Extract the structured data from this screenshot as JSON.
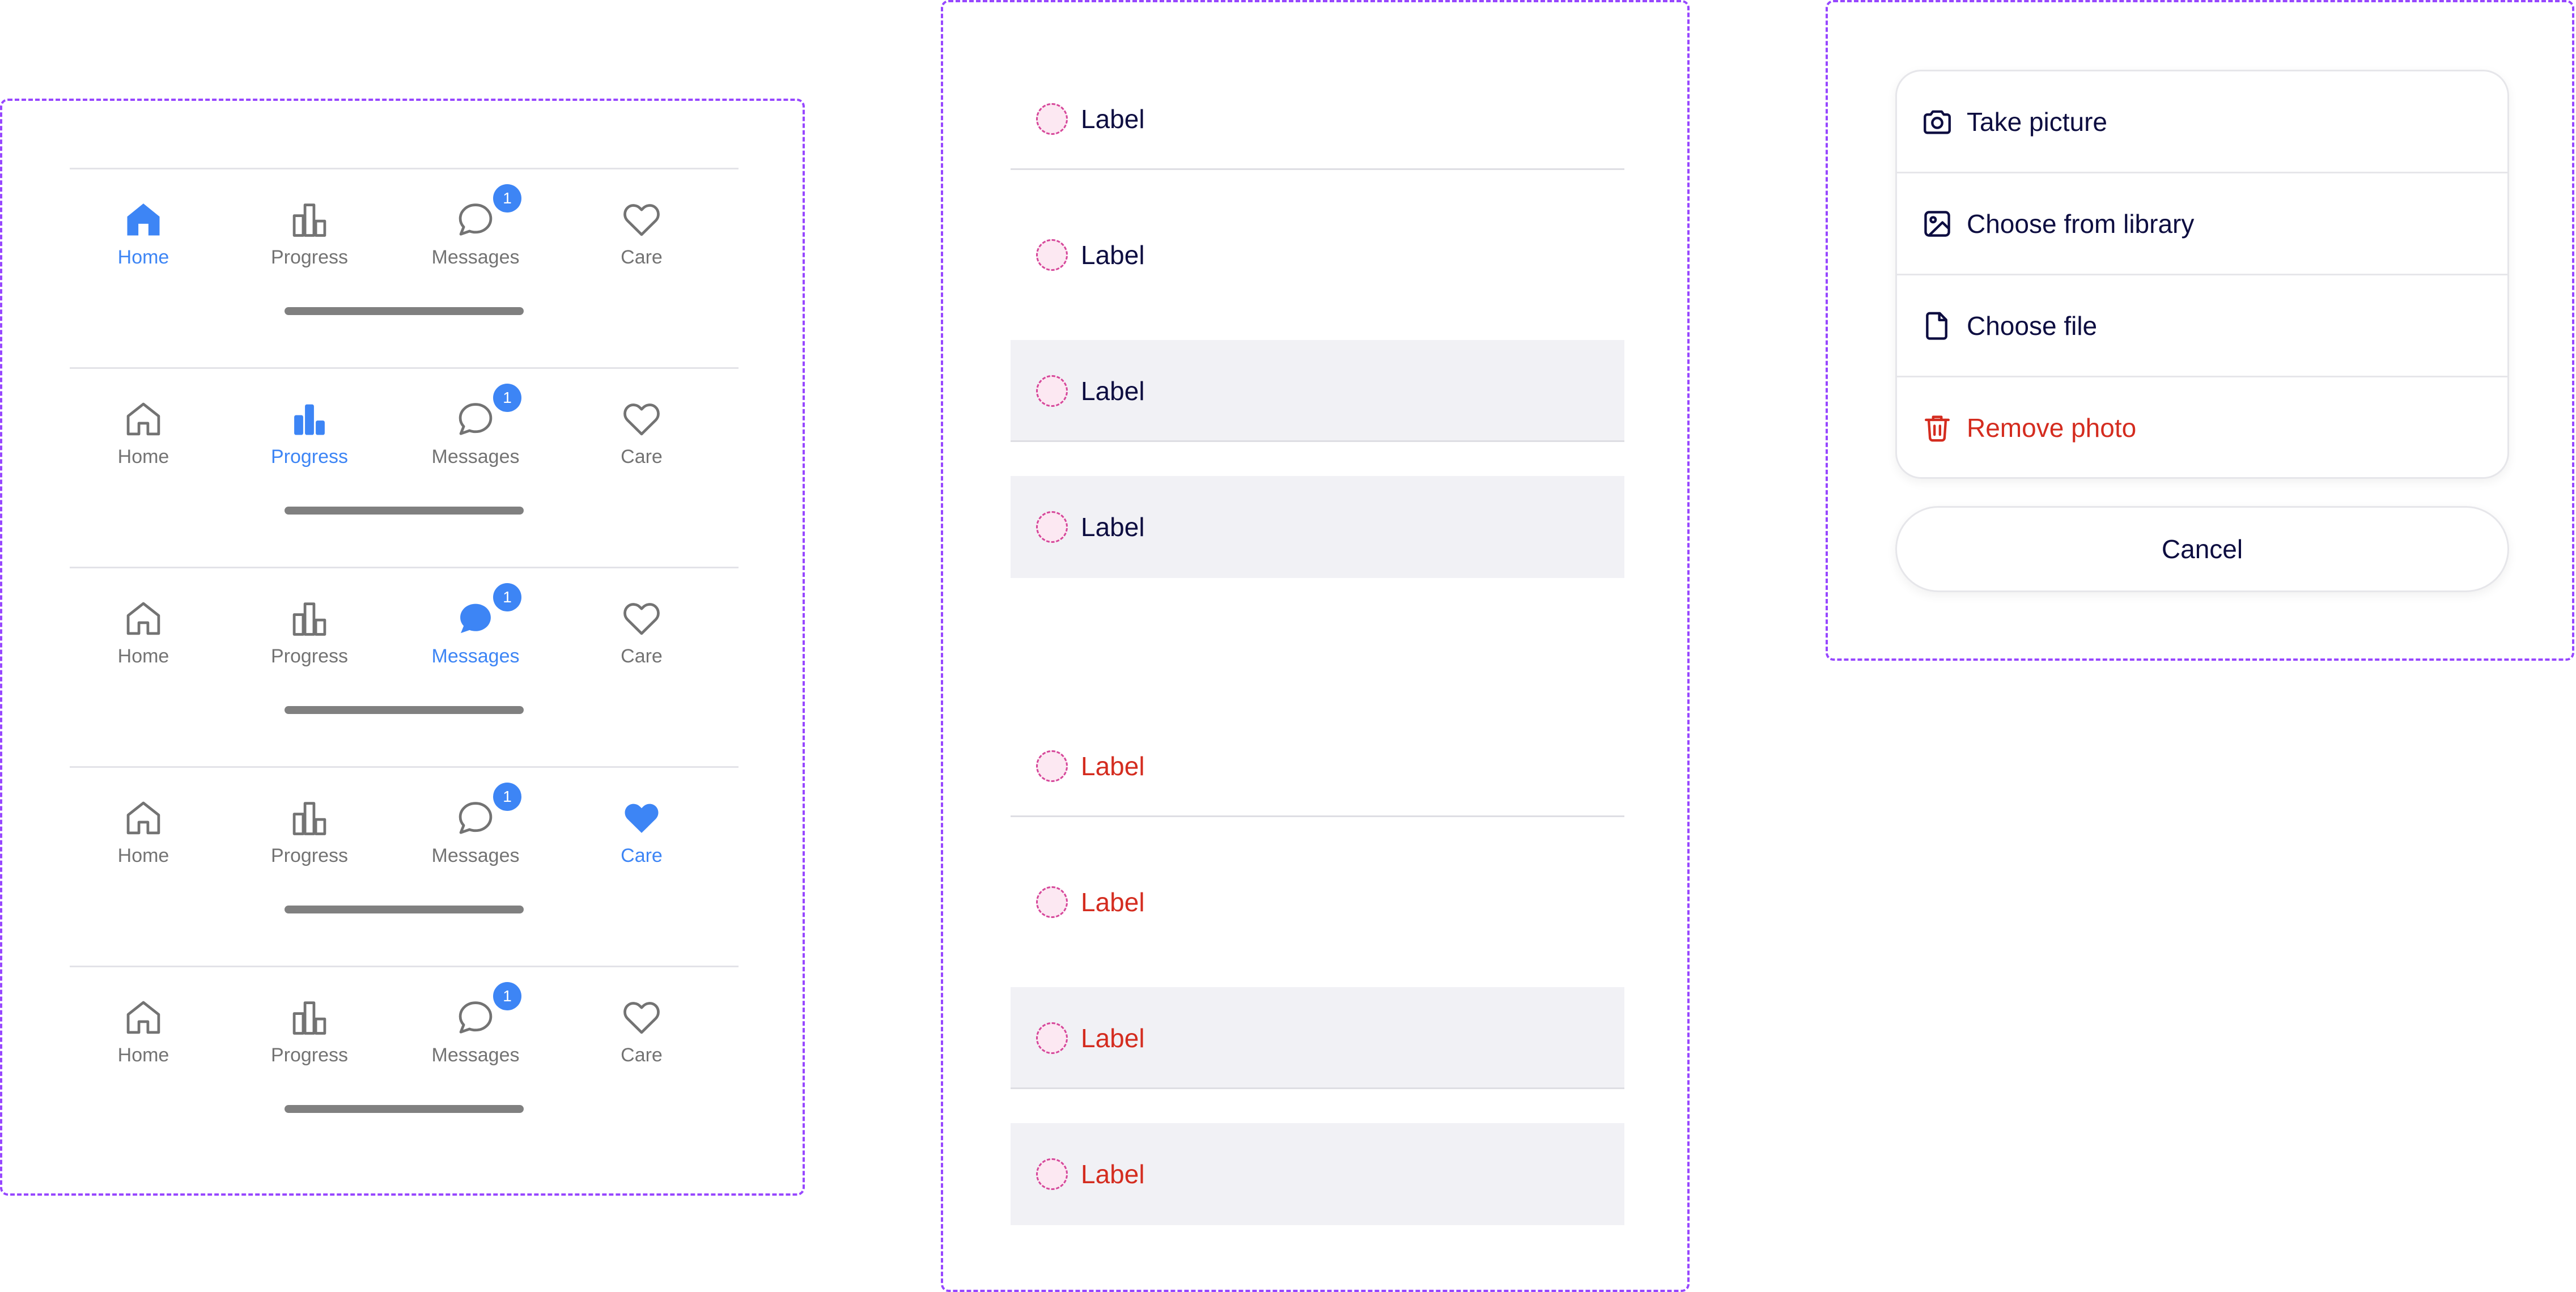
{
  "colors": {
    "frame_border": "#9747ff",
    "active": "#3d85f5",
    "inactive": "#737373",
    "danger": "#d42c1f",
    "text": "#0d0d40",
    "filled_bg": "#f1f1f5"
  },
  "tabbars": [
    {
      "active": "home",
      "tabs": [
        {
          "id": "home",
          "label": "Home",
          "icon": "home-icon"
        },
        {
          "id": "progress",
          "label": "Progress",
          "icon": "chart-icon"
        },
        {
          "id": "messages",
          "label": "Messages",
          "icon": "chat-bubble-icon",
          "badge": "1"
        },
        {
          "id": "care",
          "label": "Care",
          "icon": "heart-icon"
        }
      ]
    },
    {
      "active": "progress",
      "tabs": [
        {
          "id": "home",
          "label": "Home",
          "icon": "home-icon"
        },
        {
          "id": "progress",
          "label": "Progress",
          "icon": "chart-icon"
        },
        {
          "id": "messages",
          "label": "Messages",
          "icon": "chat-bubble-icon",
          "badge": "1"
        },
        {
          "id": "care",
          "label": "Care",
          "icon": "heart-icon"
        }
      ]
    },
    {
      "active": "messages",
      "tabs": [
        {
          "id": "home",
          "label": "Home",
          "icon": "home-icon"
        },
        {
          "id": "progress",
          "label": "Progress",
          "icon": "chart-icon"
        },
        {
          "id": "messages",
          "label": "Messages",
          "icon": "chat-bubble-icon",
          "badge": "1"
        },
        {
          "id": "care",
          "label": "Care",
          "icon": "heart-icon"
        }
      ]
    },
    {
      "active": "care",
      "tabs": [
        {
          "id": "home",
          "label": "Home",
          "icon": "home-icon"
        },
        {
          "id": "progress",
          "label": "Progress",
          "icon": "chart-icon"
        },
        {
          "id": "messages",
          "label": "Messages",
          "icon": "chat-bubble-icon",
          "badge": "1"
        },
        {
          "id": "care",
          "label": "Care",
          "icon": "heart-icon"
        }
      ]
    },
    {
      "active": "",
      "tabs": [
        {
          "id": "home",
          "label": "Home",
          "icon": "home-icon"
        },
        {
          "id": "progress",
          "label": "Progress",
          "icon": "chart-icon"
        },
        {
          "id": "messages",
          "label": "Messages",
          "icon": "chat-bubble-icon",
          "badge": "1"
        },
        {
          "id": "care",
          "label": "Care",
          "icon": "heart-icon"
        }
      ]
    }
  ],
  "list_items": [
    {
      "label": "Label",
      "variant": "bordered",
      "tone": "default"
    },
    {
      "label": "Label",
      "variant": "plain",
      "tone": "default"
    },
    {
      "label": "Label",
      "variant": "filled-bordered",
      "tone": "default"
    },
    {
      "label": "Label",
      "variant": "filled",
      "tone": "default"
    },
    {
      "label": "Label",
      "variant": "bordered",
      "tone": "danger"
    },
    {
      "label": "Label",
      "variant": "plain",
      "tone": "danger"
    },
    {
      "label": "Label",
      "variant": "filled-bordered",
      "tone": "danger"
    },
    {
      "label": "Label",
      "variant": "filled",
      "tone": "danger"
    }
  ],
  "action_sheet": {
    "items": [
      {
        "label": "Take picture",
        "icon": "camera-icon",
        "tone": "default"
      },
      {
        "label": "Choose from library",
        "icon": "image-icon",
        "tone": "default"
      },
      {
        "label": "Choose file",
        "icon": "file-icon",
        "tone": "default"
      },
      {
        "label": "Remove photo",
        "icon": "trash-icon",
        "tone": "danger"
      }
    ],
    "cancel_label": "Cancel"
  }
}
